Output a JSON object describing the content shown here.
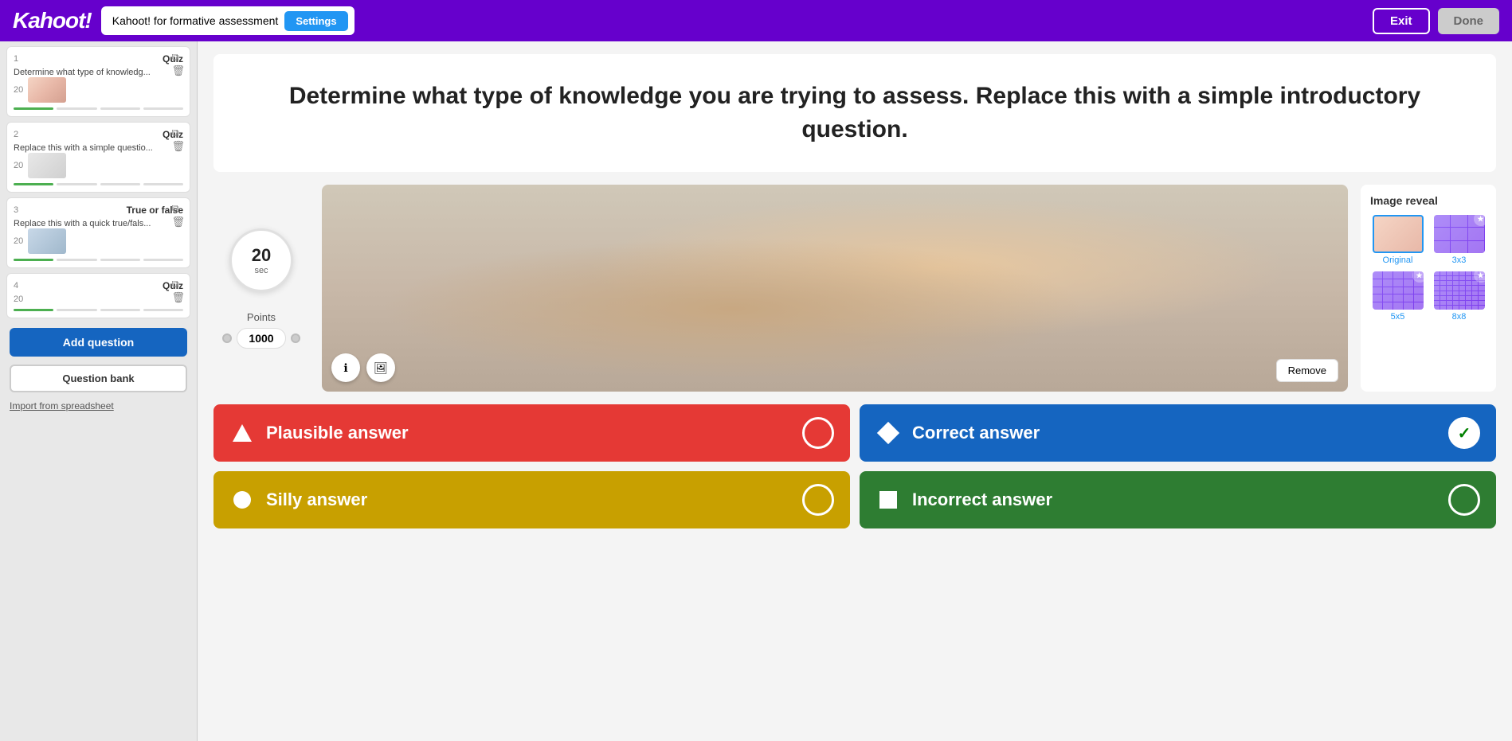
{
  "header": {
    "logo": "Kahoot!",
    "title": "Kahoot! for formative assessment",
    "settings_label": "Settings",
    "exit_label": "Exit",
    "done_label": "Done"
  },
  "sidebar": {
    "items": [
      {
        "num": "1",
        "type": "Quiz",
        "text": "Determine what type of knowledg...",
        "pts": "20",
        "has_image": true,
        "image_class": "quiz-thumb-img"
      },
      {
        "num": "2",
        "type": "Quiz",
        "text": "Replace this with a simple questio...",
        "pts": "20",
        "has_image": true,
        "image_class": "quiz-thumb-img2"
      },
      {
        "num": "3",
        "type": "True or false",
        "text": "Replace this with a quick true/fals...",
        "pts": "20",
        "has_image": true,
        "image_class": "quiz-thumb-img3"
      },
      {
        "num": "4",
        "type": "Quiz",
        "text": "",
        "pts": "20",
        "has_image": false,
        "image_class": ""
      }
    ],
    "add_question_label": "Add question",
    "question_bank_label": "Question bank",
    "import_label": "Import from spreadsheet"
  },
  "question": {
    "text": "Determine what type of knowledge you are trying to assess. Replace this with a simple introductory question."
  },
  "timer": {
    "value": "20",
    "unit": "sec"
  },
  "points": {
    "label": "Points",
    "value": "1000"
  },
  "image_reveal": {
    "title": "Image reveal",
    "options": [
      {
        "label": "Original",
        "type": "original",
        "selected": true,
        "badge": false
      },
      {
        "label": "3x3",
        "type": "3x3",
        "selected": false,
        "badge": true
      },
      {
        "label": "5x5",
        "type": "5x5",
        "selected": false,
        "badge": true
      },
      {
        "label": "8x8",
        "type": "8x8",
        "selected": false,
        "badge": true
      }
    ]
  },
  "image": {
    "remove_label": "Remove"
  },
  "answers": [
    {
      "id": "a1",
      "text": "Plausible answer",
      "color": "red",
      "icon": "triangle",
      "correct": false
    },
    {
      "id": "a2",
      "text": "Correct answer",
      "color": "blue",
      "icon": "diamond",
      "correct": true
    },
    {
      "id": "a3",
      "text": "Silly answer",
      "color": "yellow",
      "icon": "circle",
      "correct": false
    },
    {
      "id": "a4",
      "text": "Incorrect answer",
      "color": "green",
      "icon": "square",
      "correct": false
    }
  ]
}
